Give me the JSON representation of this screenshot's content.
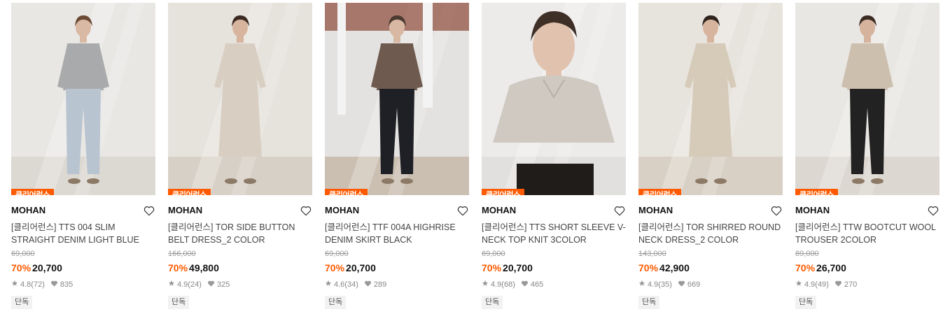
{
  "products": [
    {
      "badge": "클리어런스",
      "brand": "MOHAN",
      "name": "[클리어런스] TTS 004 SLIM STRAIGHT DENIM LIGHT BLUE",
      "original_price": "69,000",
      "discount": "70%",
      "price": "20,700",
      "rating": "4.8",
      "reviews": "(72)",
      "likes": "835",
      "tag": "단독",
      "bg": "#e9e7e4",
      "floor": "#dcd8d2",
      "top": "#a9aaac",
      "bottom": "#b8c4d0",
      "skin": "#d9b9a4",
      "hair": "#6a4a35"
    },
    {
      "badge": "클리어런스",
      "brand": "MOHAN",
      "name": "[클리어런스] TOR SIDE BUTTON BELT DRESS_2 COLOR",
      "original_price": "166,000",
      "discount": "70%",
      "price": "49,800",
      "rating": "4.9",
      "reviews": "(24)",
      "likes": "325",
      "tag": "단독",
      "bg": "#e6e2dc",
      "floor": "#d7d0c6",
      "top": "#d8cfc2",
      "bottom": "#d8cfc2",
      "skin": "#d6b49d",
      "hair": "#3a2a22"
    },
    {
      "badge": "클리어런스",
      "brand": "MOHAN",
      "name": "[클리어런스] TTF 004A HIGHRISE DENIM SKIRT BLACK",
      "original_price": "",
      "discount": "",
      "price": "",
      "rating": "4.6",
      "reviews": "(34)",
      "likes": "289",
      "tag": "단독",
      "bg": "#e4e2e0",
      "floor": "#cbbfb2",
      "top": "#6e5a4e",
      "bottom": "#1e2026",
      "skin": "#d8b8a3",
      "hair": "#4b3a30"
    },
    {
      "badge": "클리어런스",
      "brand": "MOHAN",
      "name": "[클리어런스] TTS SHORT SLEEVE V-NECK TOP KNIT 3COLOR",
      "original_price": "69,000",
      "discount": "70%",
      "price": "20,700",
      "rating": "4.9",
      "reviews": "(68)",
      "likes": "465",
      "tag": "단독",
      "bg": "#ecebea",
      "floor": "#e2e0de",
      "top": "#cfc9c2",
      "bottom": "#1f1c1a",
      "skin": "#e0c2ae",
      "hair": "#3e2f27"
    },
    {
      "badge": "클리어런스",
      "brand": "MOHAN",
      "name": "[클리어런스] TOR SHIRRED ROUND NECK DRESS_2 COLOR",
      "original_price": "143,000",
      "discount": "70%",
      "price": "42,900",
      "rating": "4.9",
      "reviews": "(35)",
      "likes": "669",
      "tag": "단독",
      "bg": "#e7e3dd",
      "floor": "#d8d0c5",
      "top": "#d6cab9",
      "bottom": "#d6cab9",
      "skin": "#d6b49d",
      "hair": "#2e231d"
    },
    {
      "badge": "클리어런스",
      "brand": "MOHAN",
      "name": "[클리어런스] TTW BOOTCUT WOOL TROUSER 2COLOR",
      "original_price": "89,000",
      "discount": "70%",
      "price": "26,700",
      "rating": "4.9",
      "reviews": "(49)",
      "likes": "270",
      "tag": "단독",
      "bg": "#e9e7e3",
      "floor": "#dcd7d0",
      "top": "#cdbfae",
      "bottom": "#222222",
      "skin": "#d5b39c",
      "hair": "#3a2b23"
    }
  ],
  "third_original_price": "69,000",
  "third_discount": "70%",
  "third_price": "20,700"
}
